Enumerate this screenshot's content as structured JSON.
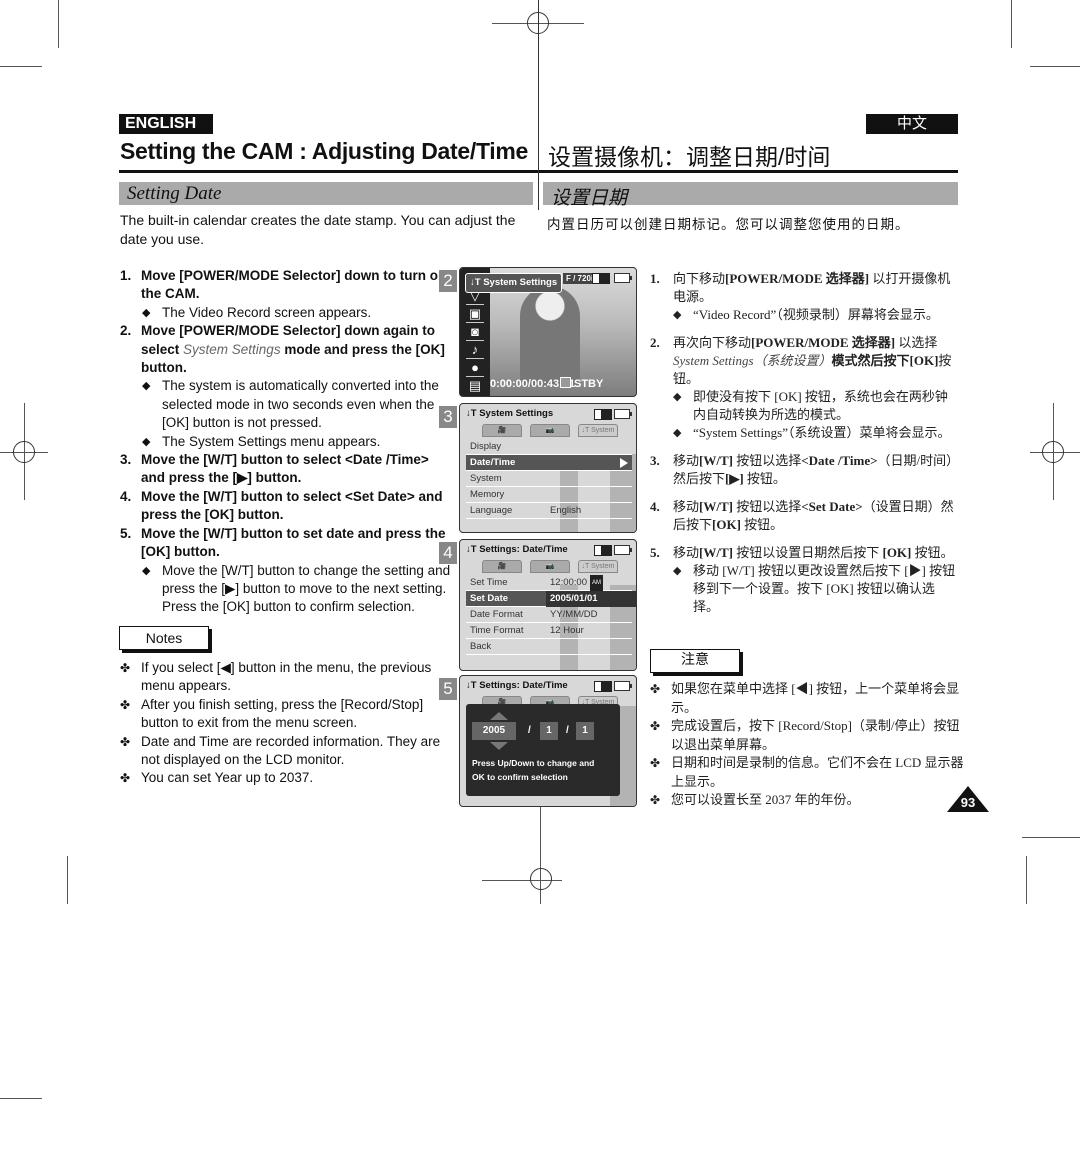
{
  "header": {
    "lang_en": "ENGLISH",
    "lang_zh": "中文",
    "title_en": "Setting the CAM : Adjusting Date/Time",
    "title_zh": "设置摄像机：调整日期/时间"
  },
  "section": {
    "title_en": "Setting Date",
    "title_zh": "设置日期"
  },
  "intro": {
    "en": "The built-in calendar creates the date stamp. You can adjust the date you use.",
    "zh": "内置日历可以创建日期标记。您可以调整您使用的日期。"
  },
  "steps_en": [
    {
      "num": "1.",
      "text": "Move [POWER/MODE Selector] down to turn on the CAM.",
      "bullets": [
        "The Video Record screen appears."
      ]
    },
    {
      "num": "2.",
      "text_before": "Move [POWER/MODE Selector] down again to select ",
      "text_italic": "System Settings",
      "text_after": " mode and press the [OK] button.",
      "bullets": [
        "The system is automatically converted into the selected mode in two seconds even when the [OK] button is not pressed.",
        "The System Settings menu appears."
      ]
    },
    {
      "num": "3.",
      "text": "Move the [W/T] button to select <Date /Time> and press the [▶] button.",
      "bullets": []
    },
    {
      "num": "4.",
      "text": "Move the [W/T] button to select <Set Date> and press the [OK] button.",
      "bullets": []
    },
    {
      "num": "5.",
      "text": "Move the [W/T] button to set date and press the [OK] button.",
      "bullets": [
        "Move the [W/T] button to change the setting and press the [▶] button to move to the next setting. Press the [OK] button to confirm selection."
      ]
    }
  ],
  "notes_en": {
    "label": "Notes",
    "items": [
      "If you select [◀] button in the menu, the previous menu appears.",
      "After you finish setting, press the [Record/Stop] button to exit from the menu screen.",
      "Date and Time are recorded information. They are not displayed on the LCD monitor.",
      "You can set Year up to 2037."
    ]
  },
  "screens": {
    "s2": {
      "num": "2",
      "label": "System Settings",
      "resolution": "F / 720i",
      "timecode": "0:00:00/00:43:41",
      "status": "STBY",
      "side_icons": [
        "triangle-down-icon",
        "video-camera-icon",
        "camera-icon",
        "music-note-icon",
        "microphone-icon",
        "document-icon"
      ]
    },
    "s3": {
      "num": "3",
      "title": "System Settings",
      "tabs": [
        "🎥",
        "📷",
        "↓T System"
      ],
      "rows": [
        {
          "label": "Display",
          "value": ""
        },
        {
          "label": "Date/Time",
          "value": "",
          "selected": true
        },
        {
          "label": "System",
          "value": ""
        },
        {
          "label": "Memory",
          "value": ""
        },
        {
          "label": "Language",
          "value": "English"
        }
      ]
    },
    "s4": {
      "num": "4",
      "title": "Settings: Date/Time",
      "tabs": [
        "🎥",
        "📷",
        "↓T System"
      ],
      "rows": [
        {
          "label": "Set Time",
          "value": "12:00:00",
          "badge": "AM"
        },
        {
          "label": "Set Date",
          "value": "2005/01/01",
          "selected": true
        },
        {
          "label": "Date Format",
          "value": "YY/MM/DD"
        },
        {
          "label": "Time Format",
          "value": "12 Hour"
        },
        {
          "label": "Back",
          "value": ""
        }
      ]
    },
    "s5": {
      "num": "5",
      "title": "Settings: Date/Time",
      "tabs": [
        "🎥",
        "📷",
        "↓T System"
      ],
      "year": "2005",
      "month": "1",
      "day": "1",
      "separator": "/",
      "message_line1": "Press Up/Down to change and",
      "message_line2": "OK to confirm selection"
    }
  },
  "steps_zh": {
    "s1_num": "1.",
    "s1_a": "向下移动",
    "s1_b": "[POWER/MODE 选择器]",
    "s1_c": " 以打开摄像机电源。",
    "s1_bullet": "“Video Record”（视频录制）屏幕将会显示。",
    "s2_num": "2.",
    "s2_a": "再次向下移动",
    "s2_b": "[POWER/MODE 选择器]",
    "s2_c": " 以选择",
    "s2_it": "System Settings（系统设置）",
    "s2_d": "模式然后按下",
    "s2_e": "[OK]",
    "s2_f": "按钮。",
    "s2_bullet1": "即使没有按下 [OK] 按钮，系统也会在两秒钟内自动转换为所选的模式。",
    "s2_bullet2": "“System Settings”（系统设置）菜单将会显示。",
    "s3_num": "3.",
    "s3_a": "移动",
    "s3_b": "[W/T]",
    "s3_c": " 按钮以选择",
    "s3_d": "<Date /Time>",
    "s3_e": "（日期/时间）然后按下",
    "s3_f": "[▶]",
    "s3_g": " 按钮。",
    "s4_num": "4.",
    "s4_a": "移动",
    "s4_b": "[W/T]",
    "s4_c": " 按钮以选择",
    "s4_d": "<Set Date>",
    "s4_e": "（设置日期）然后按下",
    "s4_f": "[OK]",
    "s4_g": " 按钮。",
    "s5_num": "5.",
    "s5_a": "移动",
    "s5_b": "[W/T]",
    "s5_c": " 按钮以设置日期然后按下 ",
    "s5_d": "[OK]",
    "s5_e": " 按钮。",
    "s5_bullet": "移动 [W/T] 按钮以更改设置然后按下 [▶] 按钮移到下一个设置。按下 [OK] 按钮以确认选择。"
  },
  "notes_zh": {
    "label": "注意",
    "items": [
      "如果您在菜单中选择 [◀] 按钮，上一个菜单将会显示。",
      "完成设置后，按下 [Record/Stop]（录制/停止）按钮以退出菜单屏幕。",
      "日期和时间是录制的信息。它们不会在 LCD 显示器上显示。",
      "您可以设置长至 2037 年的年份。"
    ]
  },
  "page_number": "93",
  "symbols": {
    "diamond": "◆",
    "club": "✤"
  }
}
